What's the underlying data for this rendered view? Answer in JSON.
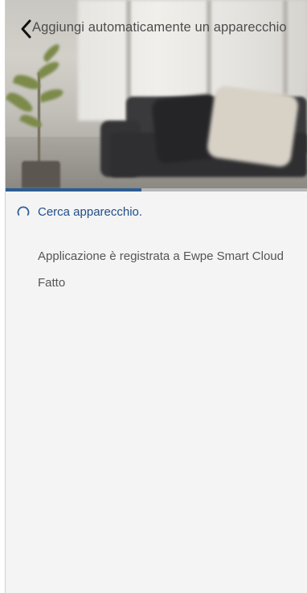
{
  "header": {
    "title": "Aggiungi automaticamente un apparecchio",
    "back_icon": "chevron-left-icon"
  },
  "progress": {
    "fraction": 0.45,
    "fill_color": "#2d5d94",
    "track_color": "#b7b7b7"
  },
  "steps": [
    {
      "label": "Cerca apparecchio.",
      "state": "active",
      "icon": "loading-spinner-icon"
    },
    {
      "label": "Applicazione è registrata a Ewpe Smart Cloud",
      "state": "pending"
    },
    {
      "label": "Fatto",
      "state": "pending"
    }
  ],
  "colors": {
    "accent": "#1f4e8a",
    "background": "#f4f4f4",
    "text_muted": "#555555"
  }
}
